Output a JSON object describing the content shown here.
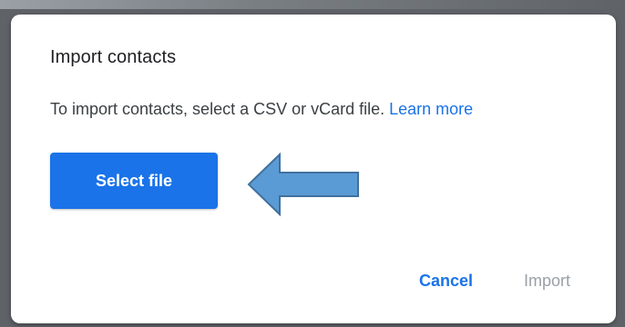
{
  "dialog": {
    "title": "Import contacts",
    "description": "To import contacts, select a CSV or vCard file.",
    "learn_more": "Learn more",
    "select_file_label": "Select file",
    "cancel_label": "Cancel",
    "import_label": "Import"
  },
  "annotation": {
    "icon": "left-arrow-icon",
    "fill_color": "#5b9bd5",
    "stroke_color": "#41719c"
  },
  "colors": {
    "accent": "#1a73e8",
    "disabled": "#9aa0a6"
  }
}
